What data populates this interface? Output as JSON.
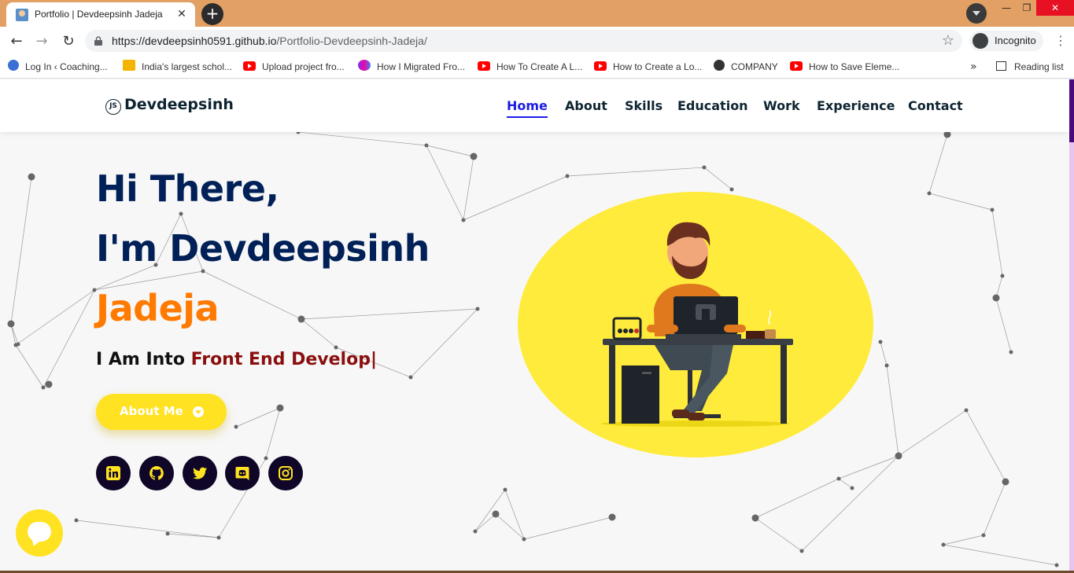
{
  "browser": {
    "tab_title": "Portfolio | Devdeepsinh Jadeja",
    "tab_close": "✕",
    "new_tab": "+",
    "url_domain": "https://devdeepsinh0591.github.io",
    "url_path": "/Portfolio-Devdeepsinh-Jadeja/",
    "incognito_label": "Incognito",
    "window_min": "—",
    "window_max": "❐",
    "window_close": "✕",
    "bookmarks": [
      {
        "label": "Log In ‹ Coaching...",
        "icon": "wordpress-icon"
      },
      {
        "label": "India's largest schol...",
        "icon": "graduation-icon"
      },
      {
        "label": "Upload project fro...",
        "icon": "youtube-icon"
      },
      {
        "label": "How I Migrated Fro...",
        "icon": "app-icon"
      },
      {
        "label": "How To Create A L...",
        "icon": "youtube-icon"
      },
      {
        "label": "How to Create a Lo...",
        "icon": "youtube-icon"
      },
      {
        "label": "COMPANY",
        "icon": "globe-icon"
      },
      {
        "label": "How to Save Eleme...",
        "icon": "youtube-icon"
      }
    ],
    "bookmarks_more": "»",
    "reading_list": "Reading list"
  },
  "site": {
    "logo_icon_text": "JS",
    "logo": "Devdeepsinh",
    "nav": [
      "Home",
      "About",
      "Skills",
      "Education",
      "Work",
      "Experience",
      "Contact"
    ],
    "active_nav": "Home",
    "hero": {
      "line1": "Hi There,",
      "line2": "I'm Devdeepsinh",
      "line3": "Jadeja",
      "typing_prefix": "I Am Into ",
      "typing_word": "Front End Develop|"
    },
    "about_button": "About Me",
    "socials": [
      "linkedin-icon",
      "github-icon",
      "twitter-icon",
      "discord-icon",
      "instagram-icon"
    ]
  },
  "colors": {
    "heading": "#002057",
    "accent_orange": "#ff7a00",
    "typing_red": "#8a0f0f",
    "button_yellow": "#ffe221",
    "nav_active": "#1c1ce6",
    "social_bg": "#0f0628",
    "tabbar": "#e2a064"
  }
}
